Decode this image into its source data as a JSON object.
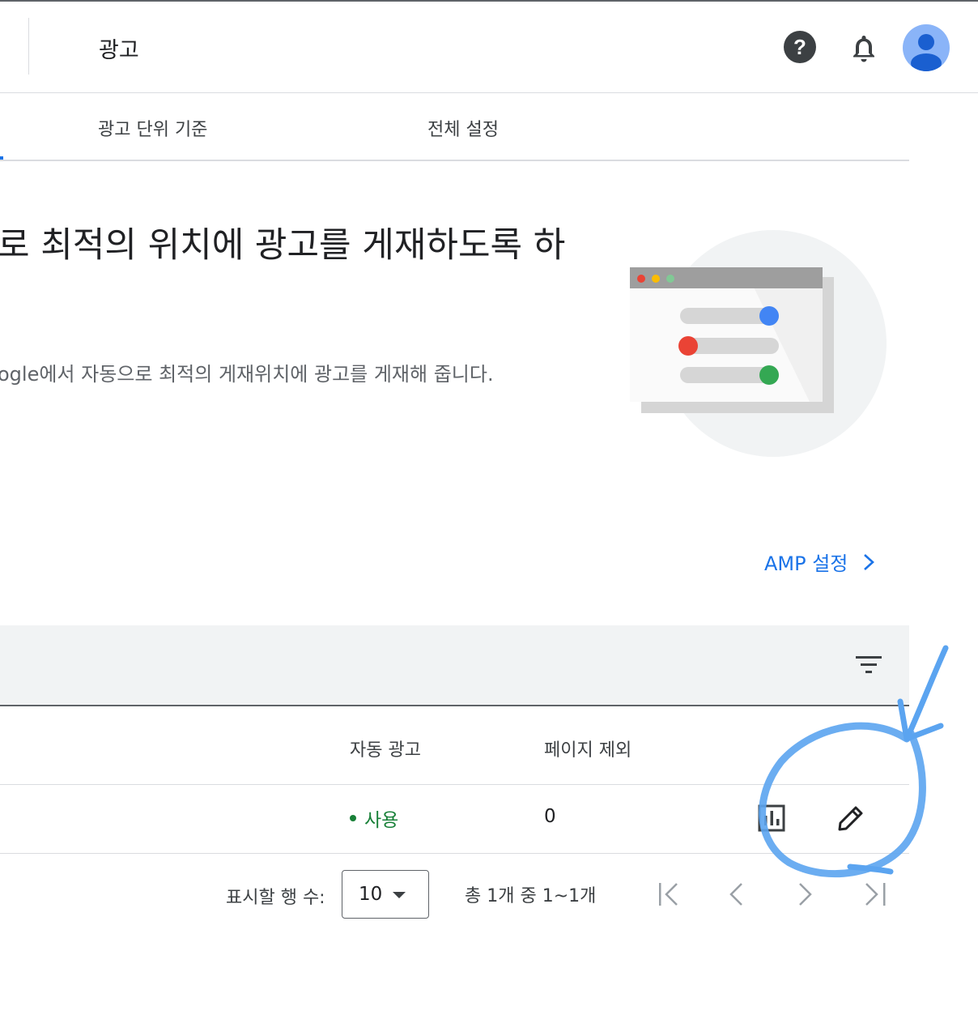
{
  "header": {
    "title": "광고",
    "help_icon": "help-circle-icon",
    "notifications_icon": "bell-icon",
    "avatar_icon": "account-avatar-icon"
  },
  "tabs": [
    {
      "label": "광고 단위 기준"
    },
    {
      "label": "전체 설정"
    }
  ],
  "hero": {
    "title": "로 최적의 위치에 광고를 게재하도록 하",
    "description": "ogle에서 자동으로 최적의 게재위치에 광고를 게재해 줍니다."
  },
  "amp_link": {
    "label": "AMP 설정",
    "icon": "chevron-right-icon"
  },
  "table": {
    "filter_icon": "filter-list-icon",
    "columns": [
      "자동 광고",
      "페이지 제외"
    ],
    "rows": [
      {
        "auto_ads": "사용",
        "page_exclusions": "0",
        "report_icon": "bar-chart-report-icon",
        "edit_icon": "pencil-edit-icon"
      }
    ]
  },
  "pagination": {
    "rows_label": "표시할 행 수:",
    "rows_value": "10",
    "range_text": "총 1개 중 1~1개"
  },
  "colors": {
    "accent": "#1a73e8",
    "status_green": "#188038",
    "annotation_blue": "#5ba4f0",
    "avatar_bg": "#8ab4f8"
  }
}
